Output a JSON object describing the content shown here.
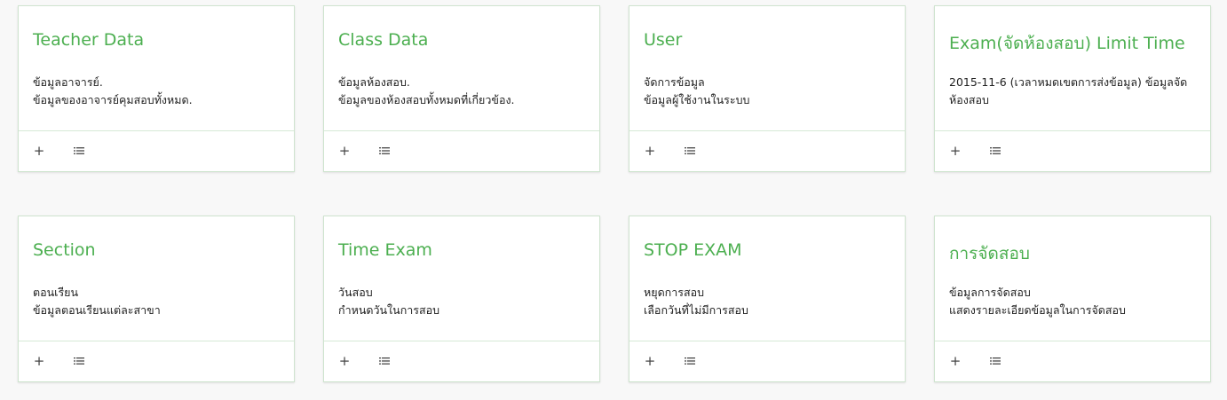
{
  "actions": {
    "add_icon": "+",
    "add_icon_name": "plus-icon",
    "list_icon_name": "list-icon"
  },
  "colors": {
    "title": "#4caf50",
    "border": "#cfe4cf",
    "background": "#f8f8f8"
  },
  "cards": [
    {
      "title": "Teacher Data",
      "lines": [
        "ข้อมูลอาจารย์.",
        "ข้อมูลของอาจารย์คุมสอบทั้งหมด."
      ]
    },
    {
      "title": "Class Data",
      "lines": [
        "ข้อมูลห้องสอบ.",
        "ข้อมูลของห้องสอบทั้งหมดที่เกี่ยวข้อง."
      ]
    },
    {
      "title": "User",
      "lines": [
        "จัดการข้อมูล",
        "ข้อมูลผู้ใช้งานในระบบ"
      ]
    },
    {
      "title": "Exam(จัดห้องสอบ) Limit Time",
      "lines": [
        "2015-11-6 (เวลาหมดเขตการส่งข้อมูล) ข้อมูลจัดห้องสอบ"
      ]
    },
    {
      "title": "Section",
      "lines": [
        "ตอนเรียน",
        "ข้อมูลตอนเรียนแต่ละสาขา"
      ]
    },
    {
      "title": "Time Exam",
      "lines": [
        "วันสอบ",
        "กำหนดวันในการสอบ"
      ]
    },
    {
      "title": "STOP EXAM",
      "lines": [
        "หยุดการสอบ",
        "เลือกวันที่ไม่มีการสอบ"
      ]
    },
    {
      "title": "การจัดสอบ",
      "lines": [
        "ข้อมูลการจัดสอบ",
        "แสดงรายละเอียดข้อมูลในการจัดสอบ"
      ]
    }
  ]
}
